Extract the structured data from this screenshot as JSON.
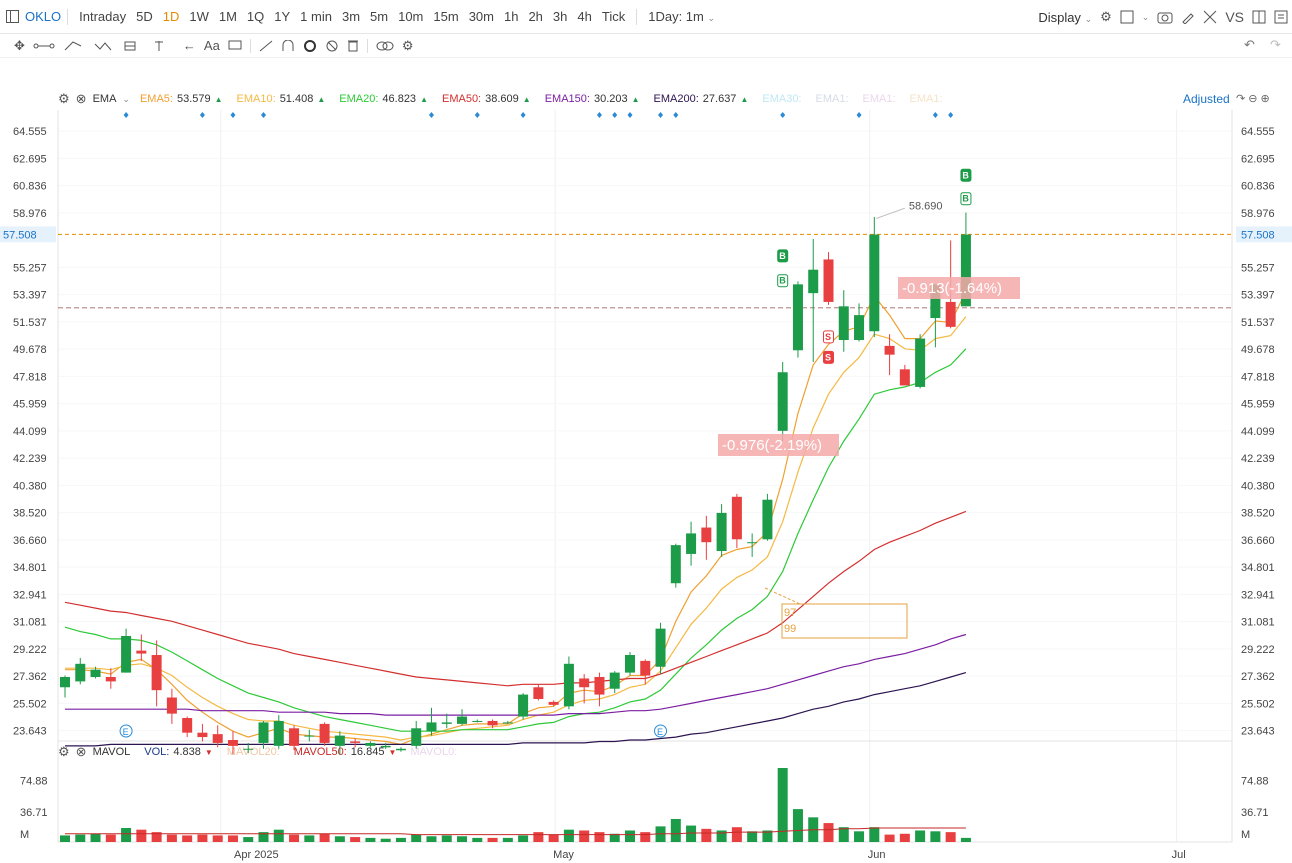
{
  "toolbar": {
    "symbol": "OKLO",
    "timeframes": [
      "Intraday",
      "5D",
      "1D",
      "1W",
      "1M",
      "1Q",
      "1Y",
      "1 min",
      "3m",
      "5m",
      "10m",
      "15m",
      "30m",
      "1h",
      "2h",
      "3h",
      "4h",
      "Tick"
    ],
    "active_timeframe": "1D",
    "interval_select": "1Day: 1m",
    "display_label": "Display",
    "vs_label": "VS",
    "font_label": "Aa"
  },
  "indicators": {
    "ema_label": "EMA",
    "items": [
      {
        "label": "EMA5:",
        "value": "53.579",
        "color": "#f0a030"
      },
      {
        "label": "EMA10:",
        "value": "51.408",
        "color": "#f4b942"
      },
      {
        "label": "EMA20:",
        "value": "46.823",
        "color": "#2dc937"
      },
      {
        "label": "EMA50:",
        "value": "38.609",
        "color": "#d32f2f"
      },
      {
        "label": "EMA150:",
        "value": "30.203",
        "color": "#7b1fa2"
      },
      {
        "label": "EMA200:",
        "value": "27.637",
        "color": "#2b1450"
      },
      {
        "label": "EMA30:",
        "value": "",
        "color": "#bfe8f5"
      },
      {
        "label": "EMA1:",
        "value": "",
        "color": "#d6dbe8"
      },
      {
        "label": "EMA1:",
        "value": "",
        "color": "#ead7ea"
      },
      {
        "label": "EMA1:",
        "value": "",
        "color": "#f5e3c8"
      }
    ],
    "adjusted_label": "Adjusted"
  },
  "volume_legend": {
    "title": "MAVOL",
    "items": [
      {
        "label": "VOL:",
        "value": "4.838",
        "color": "#1a3a8a"
      },
      {
        "label": "MAVOL20:",
        "value": "",
        "color": "#f0c8a8"
      },
      {
        "label": "MAVOL50:",
        "value": "16.845",
        "color": "#c62828"
      },
      {
        "label": "MAVOL0:",
        "value": "",
        "color": "#ead7ea"
      }
    ]
  },
  "price_axis": {
    "ticks": [
      "64.555",
      "62.695",
      "60.836",
      "58.976",
      "57.508",
      "55.257",
      "53.397",
      "51.537",
      "49.678",
      "47.818",
      "45.959",
      "44.099",
      "42.239",
      "40.380",
      "38.520",
      "36.660",
      "34.801",
      "32.941",
      "31.081",
      "29.222",
      "27.362",
      "25.502",
      "23.643"
    ],
    "current_price": "57.508"
  },
  "volume_axis": {
    "ticks": [
      "74.88",
      "36.71",
      "M"
    ]
  },
  "time_axis": {
    "labels": [
      "Apr 2025",
      "May",
      "Jun",
      "Jul"
    ]
  },
  "annotations": {
    "high_label": "58.690",
    "change_box_1": "-0.976(-2.19%)",
    "change_box_2": "-0.913(-1.64%)",
    "trend_box": [
      "97",
      "99"
    ],
    "buy_marker": "B",
    "sell_marker": "S",
    "earnings_marker": "E"
  },
  "colors": {
    "up": "#1c9b48",
    "down": "#e84040",
    "accent": "#e68a00",
    "link": "#1a73c8"
  },
  "chart_data": {
    "type": "candlestick",
    "title": "",
    "ylim": [
      23.0,
      66.0
    ],
    "candles": [
      [
        26.6,
        27.3,
        25.9,
        27.4
      ],
      [
        27.0,
        28.2,
        26.8,
        28.6
      ],
      [
        27.3,
        27.8,
        27.2,
        28.0
      ],
      [
        27.3,
        27.0,
        26.5,
        27.9
      ],
      [
        27.6,
        30.1,
        27.6,
        30.6
      ],
      [
        29.1,
        28.9,
        28.4,
        30.2
      ],
      [
        28.8,
        26.4,
        25.3,
        29.8
      ],
      [
        25.9,
        24.8,
        24.1,
        26.5
      ],
      [
        24.5,
        23.5,
        23.2,
        24.6
      ],
      [
        23.5,
        23.2,
        22.9,
        24.1
      ],
      [
        23.4,
        22.8,
        22.5,
        24.0
      ],
      [
        23.0,
        22.6,
        22.0,
        23.6
      ],
      [
        22.4,
        22.4,
        22.1,
        22.8
      ],
      [
        22.8,
        24.2,
        22.4,
        24.3
      ],
      [
        22.6,
        24.3,
        22.4,
        24.7
      ],
      [
        23.8,
        22.6,
        22.3,
        24.0
      ],
      [
        23.3,
        23.3,
        22.9,
        23.7
      ],
      [
        24.1,
        22.8,
        22.6,
        24.2
      ],
      [
        22.6,
        23.3,
        22.0,
        23.6
      ],
      [
        22.9,
        22.8,
        22.5,
        23.1
      ],
      [
        22.6,
        22.8,
        22.5,
        22.9
      ],
      [
        22.5,
        22.6,
        22.4,
        22.8
      ],
      [
        22.3,
        22.4,
        22.2,
        22.5
      ],
      [
        22.6,
        23.8,
        22.4,
        24.3
      ],
      [
        23.6,
        24.2,
        23.3,
        25.2
      ],
      [
        24.1,
        24.2,
        23.8,
        24.8
      ],
      [
        24.1,
        24.6,
        24.0,
        25.1
      ],
      [
        24.3,
        24.3,
        24.2,
        24.4
      ],
      [
        24.3,
        24.0,
        23.8,
        24.4
      ],
      [
        24.2,
        24.2,
        24.1,
        24.3
      ],
      [
        24.6,
        26.1,
        24.4,
        26.2
      ],
      [
        26.6,
        25.8,
        25.7,
        26.8
      ],
      [
        25.6,
        25.4,
        25.3,
        25.7
      ],
      [
        25.3,
        28.2,
        25.1,
        28.7
      ],
      [
        27.2,
        26.6,
        25.5,
        27.5
      ],
      [
        27.3,
        26.1,
        25.3,
        27.6
      ],
      [
        26.5,
        27.6,
        26.2,
        27.7
      ],
      [
        27.6,
        28.8,
        27.4,
        29.0
      ],
      [
        28.4,
        27.4,
        26.8,
        28.5
      ],
      [
        28.0,
        30.6,
        27.5,
        31.0
      ],
      [
        33.7,
        36.3,
        33.4,
        36.4
      ],
      [
        35.7,
        37.1,
        34.9,
        37.9
      ],
      [
        37.5,
        36.5,
        35.3,
        38.3
      ],
      [
        35.9,
        38.5,
        35.5,
        39.1
      ],
      [
        39.6,
        36.7,
        36.1,
        39.8
      ],
      [
        36.5,
        36.5,
        35.5,
        37.1
      ],
      [
        36.7,
        39.4,
        36.6,
        39.8
      ],
      [
        44.1,
        48.1,
        43.4,
        48.8
      ],
      [
        49.6,
        54.1,
        49.1,
        54.3
      ],
      [
        53.5,
        55.1,
        48.8,
        57.2
      ],
      [
        55.8,
        52.9,
        52.7,
        56.3
      ],
      [
        50.3,
        52.6,
        49.5,
        53.7
      ],
      [
        50.3,
        52.0,
        50.2,
        52.8
      ],
      [
        50.9,
        57.5,
        50.5,
        58.7
      ],
      [
        49.9,
        49.3,
        47.9,
        50.7
      ],
      [
        48.3,
        47.2,
        47.2,
        48.6
      ],
      [
        47.1,
        50.4,
        47.0,
        50.7
      ],
      [
        51.8,
        54.1,
        49.8,
        54.1
      ],
      [
        52.9,
        51.2,
        51.1,
        57.1
      ],
      [
        52.6,
        57.5,
        52.6,
        59.0
      ]
    ],
    "ema": [
      {
        "name": "EMA5",
        "color": "#f0a030",
        "values": [
          27.8,
          27.8,
          27.7,
          27.5,
          28.3,
          28.5,
          27.8,
          26.8,
          25.7,
          24.9,
          24.2,
          23.6,
          23.2,
          23.5,
          23.8,
          23.4,
          23.3,
          23.2,
          23.2,
          23.1,
          23.0,
          22.9,
          22.7,
          23.1,
          23.4,
          23.7,
          24.0,
          24.1,
          24.1,
          24.1,
          24.8,
          25.2,
          25.3,
          26.2,
          26.4,
          26.3,
          26.7,
          27.4,
          27.4,
          28.5,
          31.1,
          33.1,
          34.2,
          35.6,
          36.0,
          36.2,
          37.2,
          40.8,
          45.3,
          48.6,
          50.0,
          50.9,
          51.2,
          53.3,
          52.0,
          50.4,
          50.4,
          51.6,
          51.5,
          53.6
        ]
      },
      {
        "name": "EMA10",
        "color": "#f4b942",
        "values": [
          27.9,
          27.9,
          27.9,
          27.8,
          28.1,
          28.2,
          27.9,
          27.4,
          26.6,
          25.9,
          25.3,
          24.8,
          24.4,
          24.3,
          24.3,
          24.0,
          23.8,
          23.6,
          23.5,
          23.4,
          23.3,
          23.2,
          23.0,
          23.2,
          23.3,
          23.5,
          23.7,
          23.8,
          23.9,
          24.0,
          24.4,
          24.7,
          24.9,
          25.4,
          25.7,
          25.8,
          26.1,
          26.6,
          26.8,
          27.7,
          29.3,
          30.9,
          32.0,
          33.3,
          34.1,
          34.6,
          35.5,
          37.9,
          41.3,
          44.3,
          46.6,
          48.1,
          49.1,
          50.7,
          50.4,
          49.7,
          49.6,
          50.4,
          50.6,
          51.9
        ]
      },
      {
        "name": "EMA20",
        "color": "#2dc937",
        "values": [
          30.7,
          30.4,
          30.2,
          29.9,
          29.9,
          29.8,
          29.5,
          29.0,
          28.4,
          27.8,
          27.2,
          26.7,
          26.2,
          25.9,
          25.6,
          25.2,
          24.9,
          24.6,
          24.4,
          24.2,
          24.0,
          23.8,
          23.6,
          23.6,
          23.6,
          23.6,
          23.7,
          23.7,
          23.7,
          23.7,
          23.9,
          24.1,
          24.2,
          24.6,
          24.8,
          24.9,
          25.2,
          25.6,
          25.8,
          26.4,
          27.5,
          28.6,
          29.5,
          30.5,
          31.3,
          31.9,
          32.8,
          34.5,
          37.1,
          39.4,
          41.6,
          43.4,
          44.9,
          46.6,
          46.9,
          47.1,
          47.4,
          48.1,
          48.6,
          49.7
        ]
      },
      {
        "name": "EMA50",
        "color": "#d32f2f",
        "values": [
          32.4,
          32.2,
          32.0,
          31.8,
          31.7,
          31.5,
          31.3,
          31.1,
          30.8,
          30.5,
          30.2,
          29.9,
          29.6,
          29.4,
          29.2,
          28.9,
          28.7,
          28.5,
          28.3,
          28.1,
          27.9,
          27.7,
          27.5,
          27.3,
          27.2,
          27.1,
          27.0,
          26.9,
          26.8,
          26.7,
          26.8,
          26.8,
          26.8,
          26.9,
          26.9,
          27.0,
          27.1,
          27.2,
          27.2,
          27.5,
          27.9,
          28.3,
          28.7,
          29.1,
          29.5,
          29.9,
          30.3,
          31.0,
          31.9,
          32.8,
          33.7,
          34.5,
          35.2,
          36.0,
          36.5,
          36.9,
          37.3,
          37.8,
          38.2,
          38.6
        ]
      },
      {
        "name": "EMA150",
        "color": "#7b1fa2",
        "values": [
          25.1,
          25.1,
          25.1,
          25.1,
          25.1,
          25.1,
          25.1,
          25.1,
          25.1,
          25.0,
          25.0,
          25.0,
          25.0,
          25.0,
          24.9,
          24.9,
          24.9,
          24.9,
          24.8,
          24.8,
          24.8,
          24.7,
          24.7,
          24.7,
          24.7,
          24.7,
          24.7,
          24.7,
          24.7,
          24.7,
          24.7,
          24.7,
          24.7,
          24.8,
          24.8,
          24.8,
          24.9,
          25.0,
          25.0,
          25.1,
          25.3,
          25.5,
          25.7,
          25.9,
          26.1,
          26.3,
          26.5,
          26.8,
          27.1,
          27.4,
          27.7,
          28.0,
          28.2,
          28.5,
          28.7,
          28.9,
          29.2,
          29.5,
          29.9,
          30.2
        ]
      },
      {
        "name": "EMA200",
        "color": "#2b1450",
        "values": [
          22.6,
          22.6,
          22.6,
          22.7,
          22.7,
          22.7,
          22.7,
          22.7,
          22.7,
          22.7,
          22.7,
          22.7,
          22.7,
          22.7,
          22.7,
          22.7,
          22.7,
          22.7,
          22.7,
          22.7,
          22.7,
          22.7,
          22.7,
          22.7,
          22.7,
          22.7,
          22.7,
          22.7,
          22.7,
          22.7,
          22.8,
          22.8,
          22.8,
          22.8,
          22.8,
          22.9,
          22.9,
          23.0,
          23.0,
          23.1,
          23.2,
          23.4,
          23.5,
          23.7,
          23.9,
          24.1,
          24.3,
          24.5,
          24.8,
          25.1,
          25.3,
          25.6,
          25.8,
          26.1,
          26.3,
          26.5,
          26.7,
          27.0,
          27.3,
          27.6
        ]
      }
    ],
    "volume": {
      "ylim": [
        0,
        90
      ],
      "values": [
        8,
        9,
        10,
        9,
        17,
        15,
        12,
        9,
        8,
        9,
        8,
        8,
        6,
        12,
        15,
        9,
        8,
        10,
        7,
        6,
        5,
        4,
        5,
        9,
        7,
        8,
        7,
        5,
        5,
        5,
        8,
        12,
        9,
        15,
        14,
        12,
        10,
        14,
        12,
        19,
        28,
        20,
        16,
        14,
        18,
        13,
        14,
        90,
        40,
        30,
        23,
        18,
        13,
        18,
        9,
        10,
        14,
        13,
        12,
        5
      ],
      "mavol50": [
        10,
        10,
        10,
        10,
        10,
        10,
        10,
        10,
        10,
        10,
        10,
        10,
        10,
        10,
        10,
        10,
        10,
        10,
        10,
        10,
        10,
        10,
        10,
        9,
        9,
        9,
        9,
        9,
        9,
        9,
        9,
        9,
        9,
        9,
        9,
        9,
        9,
        9,
        9,
        10,
        10,
        11,
        11,
        11,
        12,
        12,
        12,
        13,
        14,
        15,
        15,
        16,
        16,
        17,
        17,
        17,
        17,
        17,
        17,
        17
      ]
    }
  }
}
